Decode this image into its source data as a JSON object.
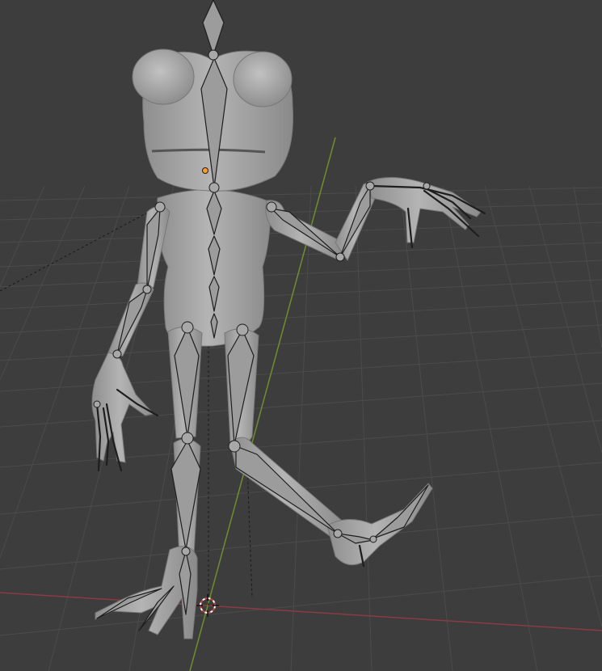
{
  "viewport": {
    "background": "#3d3d3d",
    "grid_color": "#4a4a4a",
    "x_axis_color": "#8b3b44",
    "y_axis_color": "#6f8e2e",
    "mesh_color": "#a9a9a9",
    "mesh_shadow": "#7d7d7d",
    "bone_fill": "#9c9c9c",
    "bone_stroke": "#1e1e1e",
    "cursor_color": "#c84040"
  },
  "scene": {
    "object": "frog-character-mesh",
    "armature": "frog-armature",
    "cursor_icon": "3d-cursor-icon",
    "origin_icon": "object-origin-icon"
  }
}
